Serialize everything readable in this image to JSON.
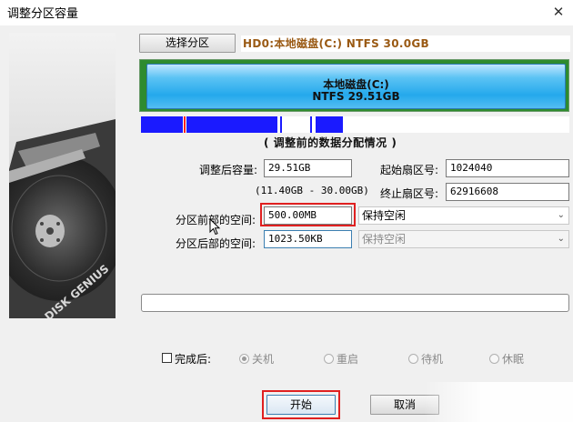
{
  "window": {
    "title": "调整分区容量",
    "close_icon": "close-icon"
  },
  "disk": {
    "select_partition_button": "选择分区",
    "info": "HD0:本地磁盘(C:) NTFS 30.0GB"
  },
  "partition": {
    "name": "本地磁盘(C:)",
    "fs_size": "NTFS 29.51GB",
    "caption": "( 调整前的数据分配情况 )"
  },
  "fields": {
    "new_size_label": "调整后容量:",
    "new_size_value": "29.51GB",
    "range_hint": "(11.40GB - 30.00GB)",
    "start_sector_label": "起始扇区号:",
    "start_sector_value": "1024040",
    "end_sector_label": "终止扇区号:",
    "end_sector_value": "62916608",
    "before_space_label": "分区前部的空间:",
    "before_space_value": "500.00MB",
    "before_space_option": "保持空闲",
    "after_space_label": "分区后部的空间:",
    "after_space_value": "1023.50KB",
    "after_space_option": "保持空闲"
  },
  "completion": {
    "label": "完成后:",
    "options": [
      "关机",
      "重启",
      "待机",
      "休眠"
    ],
    "selected": "关机"
  },
  "buttons": {
    "start": "开始",
    "cancel": "取消"
  },
  "colors": {
    "partition_blue": "#24a9ec",
    "highlight_red": "#e02020",
    "disk_info_text": "#9a5a14"
  }
}
